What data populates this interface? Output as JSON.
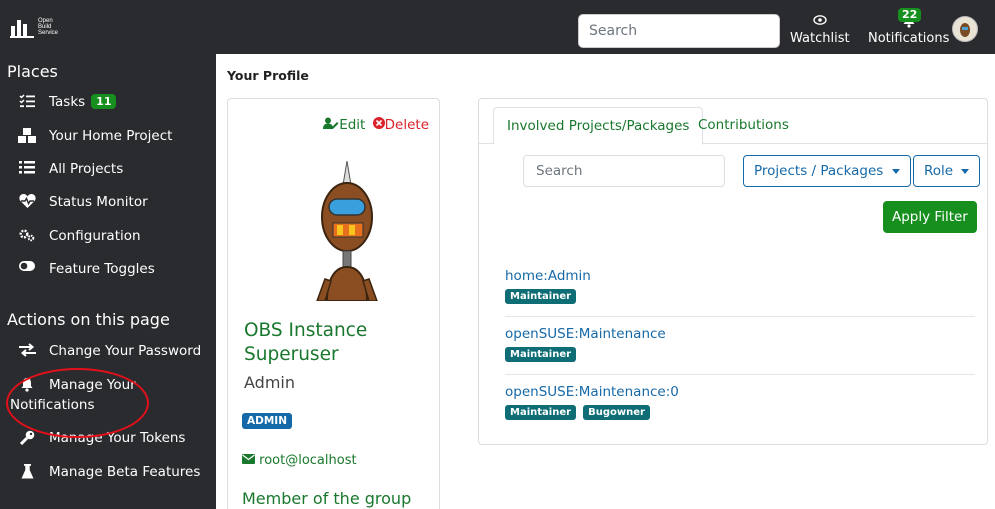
{
  "topbar": {
    "logo_lines": [
      "Open",
      "Build",
      "Service"
    ],
    "search_placeholder": "Search",
    "watchlist_label": "Watchlist",
    "notifications_label": "Notifications",
    "notifications_count": "22"
  },
  "sidebar": {
    "places_title": "Places",
    "places": [
      {
        "label": "Tasks",
        "icon": "tasks-icon",
        "badge": "11"
      },
      {
        "label": "Your Home Project",
        "icon": "cubes-icon"
      },
      {
        "label": "All Projects",
        "icon": "list-icon"
      },
      {
        "label": "Status Monitor",
        "icon": "heartbeat-icon"
      },
      {
        "label": "Configuration",
        "icon": "cogs-icon"
      },
      {
        "label": "Feature Toggles",
        "icon": "toggle-icon"
      }
    ],
    "actions_title": "Actions on this page",
    "actions": [
      {
        "label": "Change Your Password",
        "icon": "exchange-icon"
      },
      {
        "label_line1": "Manage Your",
        "label_line2": "Notifications",
        "icon": "bell-icon"
      },
      {
        "label": "Manage Your Tokens",
        "icon": "key-icon"
      },
      {
        "label": "Manage Beta Features",
        "icon": "flask-icon"
      }
    ]
  },
  "main": {
    "page_title": "Your Profile",
    "profile": {
      "edit_label": "Edit",
      "delete_label": "Delete",
      "name_line1": "OBS Instance",
      "name_line2": "Superuser",
      "login": "Admin",
      "badge": "ADMIN",
      "email": "root@localhost",
      "member_heading": "Member of the group"
    },
    "tabs": [
      "Involved Projects/Packages",
      "Contributions"
    ],
    "filter": {
      "search_placeholder": "Search",
      "projects_dropdown": "Projects / Packages",
      "role_dropdown": "Role",
      "apply_label": "Apply Filter"
    },
    "projects": [
      {
        "name": "home:Admin",
        "roles": [
          "Maintainer"
        ]
      },
      {
        "name": "openSUSE:Maintenance",
        "roles": [
          "Maintainer"
        ]
      },
      {
        "name": "openSUSE:Maintenance:0",
        "roles": [
          "Maintainer",
          "Bugowner"
        ]
      }
    ]
  },
  "colors": {
    "dark": "#2a2b2e",
    "green": "#168f1f",
    "link_green": "#19782d",
    "blue": "#1669a8",
    "teal": "#0f6d76",
    "annotation_red": "#e3101a"
  }
}
